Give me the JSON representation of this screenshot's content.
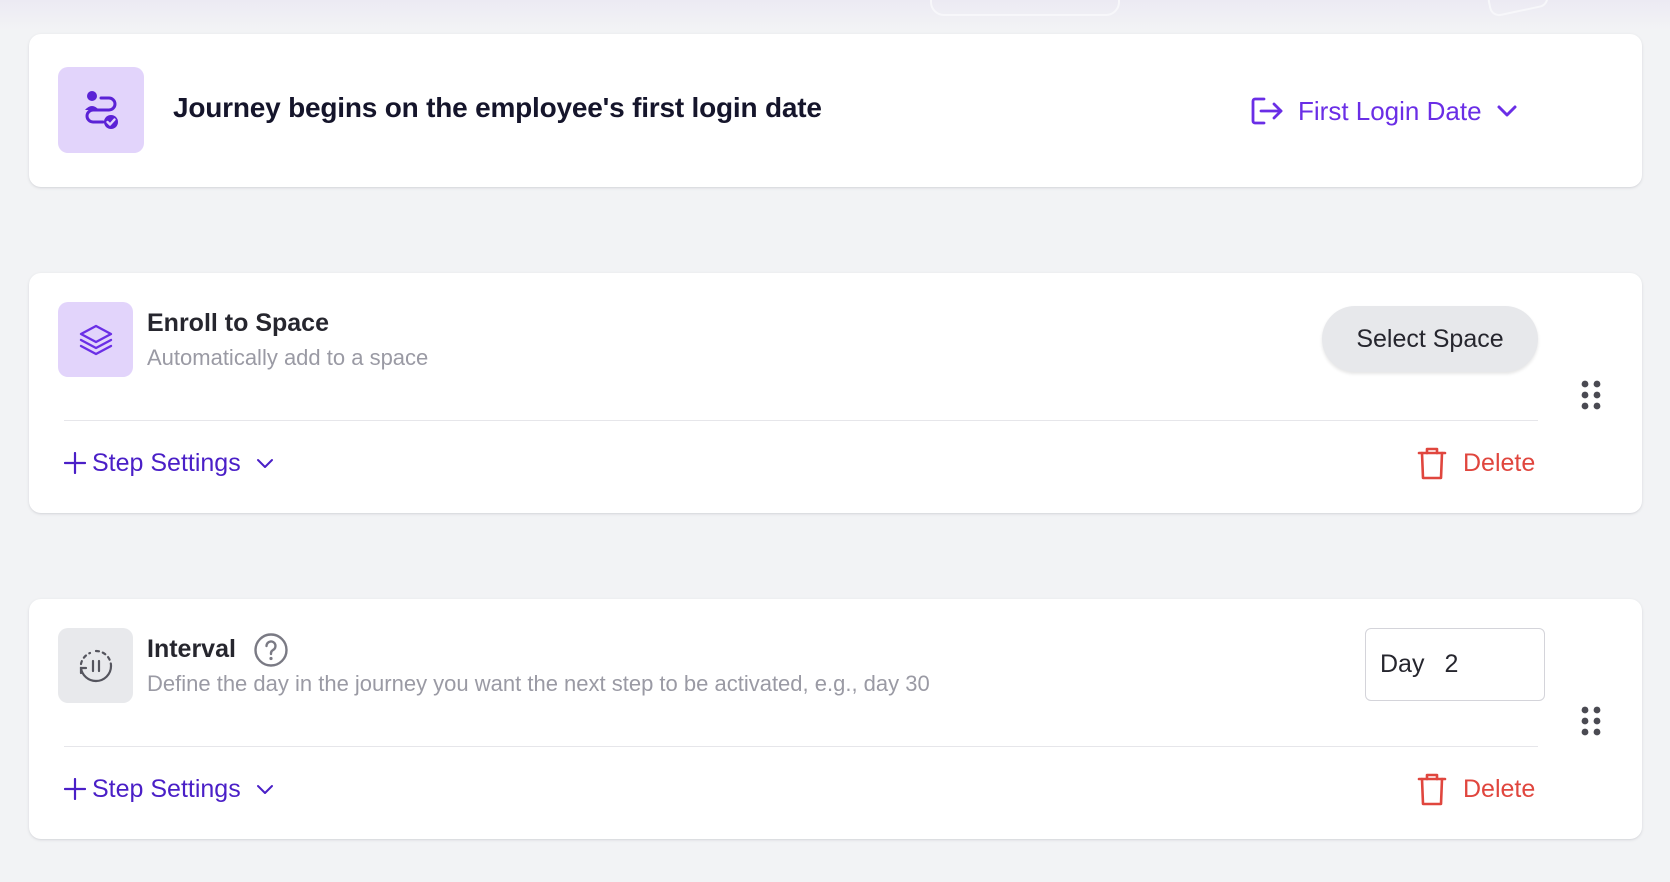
{
  "trigger": {
    "text": "Journey begins on the employee's first login date",
    "select_label": "First Login Date",
    "icon": "journey-route-icon"
  },
  "steps": [
    {
      "title": "Enroll to Space",
      "description": "Automatically add to a space",
      "icon": "layers-icon",
      "action_label": "Select Space",
      "settings_label": "Step Settings",
      "delete_label": "Delete"
    },
    {
      "title": "Interval",
      "description": "Define the day in the journey you want the next step to be activated, e.g., day 30",
      "icon": "interval-pause-icon",
      "day_label": "Day",
      "day_value": "2",
      "settings_label": "Step Settings",
      "delete_label": "Delete"
    }
  ],
  "colors": {
    "accent": "#6a2ee6",
    "accent_dark": "#4a1fc7",
    "tile_purple": "#e2d4fb",
    "delete_red": "#e0463e",
    "background": "#f2f3f5"
  }
}
